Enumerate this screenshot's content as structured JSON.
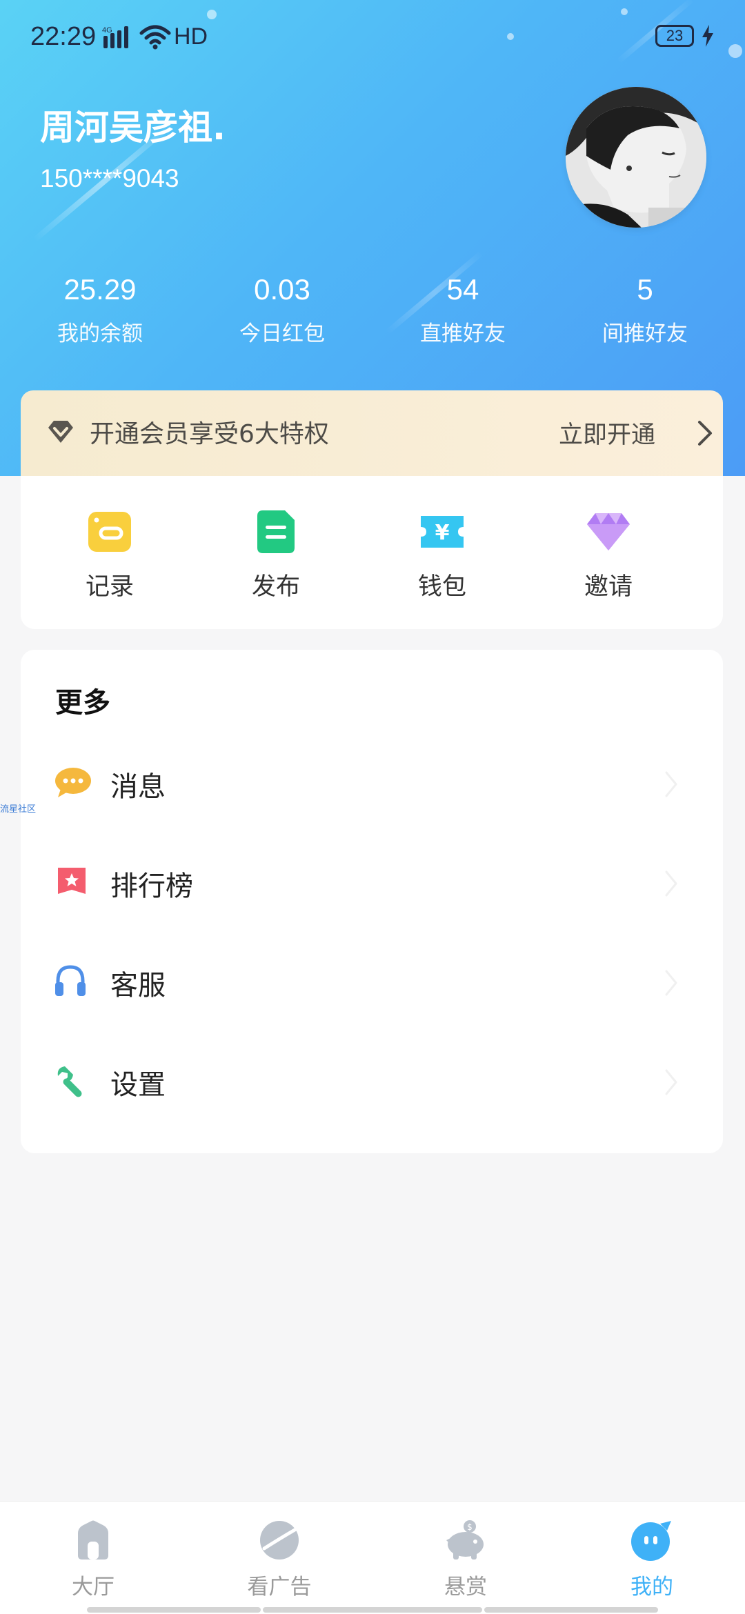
{
  "status": {
    "time": "22:29",
    "network": "4G",
    "hd": "HD",
    "battery": "23"
  },
  "user": {
    "name": "周河吴彦祖.",
    "phone": "150****9043"
  },
  "stats": [
    {
      "value": "25.29",
      "label": "我的余额"
    },
    {
      "value": "0.03",
      "label": "今日红包"
    },
    {
      "value": "54",
      "label": "直推好友"
    },
    {
      "value": "5",
      "label": "间推好友"
    }
  ],
  "vip": {
    "text": "开通会员享受6大特权",
    "action": "立即开通"
  },
  "quick_actions": [
    {
      "label": "记录",
      "icon": "record-icon",
      "color": "#f9cf3d"
    },
    {
      "label": "发布",
      "icon": "publish-icon",
      "color": "#22c982"
    },
    {
      "label": "钱包",
      "icon": "wallet-icon",
      "color": "#35c6f1"
    },
    {
      "label": "邀请",
      "icon": "diamond-icon",
      "color": "#b17cf3"
    }
  ],
  "more": {
    "title": "更多",
    "items": [
      {
        "label": "消息",
        "icon": "message-icon"
      },
      {
        "label": "排行榜",
        "icon": "ranking-icon"
      },
      {
        "label": "客服",
        "icon": "headset-icon"
      },
      {
        "label": "设置",
        "icon": "wrench-icon"
      }
    ]
  },
  "side_tag": "流星社区",
  "tabs": [
    {
      "label": "大厅",
      "icon": "home-icon",
      "active": false
    },
    {
      "label": "看广告",
      "icon": "planet-icon",
      "active": false
    },
    {
      "label": "悬赏",
      "icon": "piggy-bank-icon",
      "active": false
    },
    {
      "label": "我的",
      "icon": "profile-face-icon",
      "active": true
    }
  ],
  "colors": {
    "accent": "#3fb1f7",
    "vip_bg": "#f8ecd6",
    "page_bg": "#f6f6f7"
  }
}
